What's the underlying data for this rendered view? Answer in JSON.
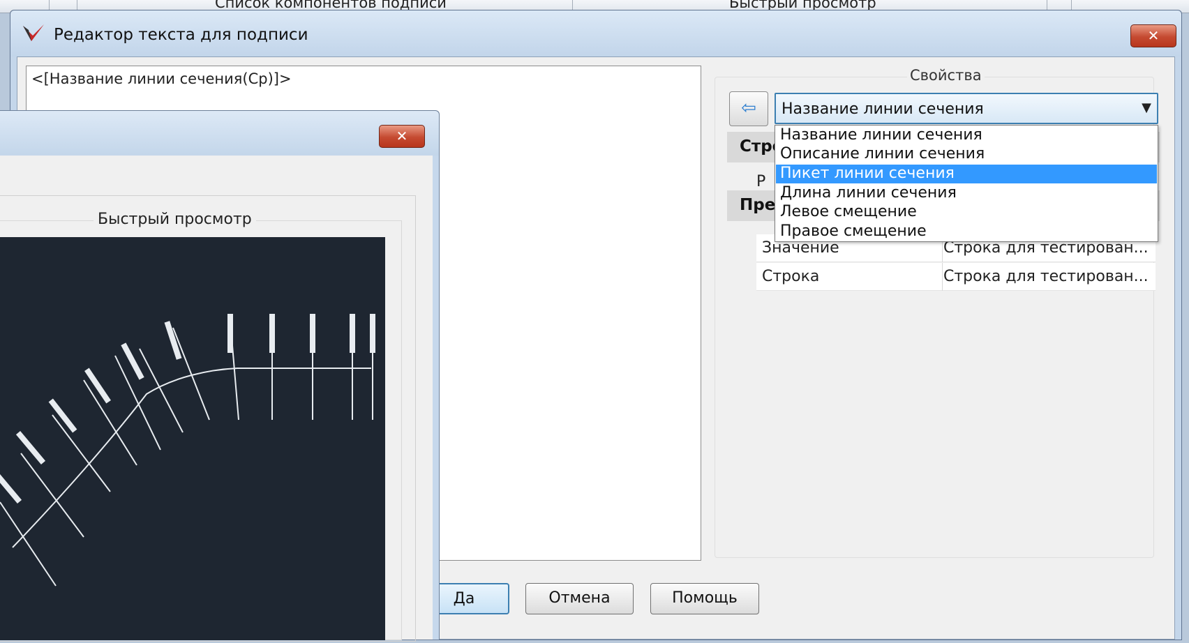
{
  "background_window": {
    "left_text": "Список компонентов подписи",
    "right_text": "Быстрый просмотр"
  },
  "main_dialog": {
    "title": "Редактор текста для подписи",
    "close_label": "✕",
    "editor_text": "<[Название линии сечения(Cp)]>",
    "properties": {
      "group_label": "Свойства",
      "back_label": "⇦",
      "combo_value": "Название линии сечения",
      "combo_arrow": "▼",
      "dropdown_options": [
        "Название линии сечения",
        "Описание линии сечения",
        "Пикет линии сечения",
        "Длина линии сечения",
        "Левое смещение",
        "Правое смещение"
      ],
      "selected_index": 2,
      "section_1": "Стро",
      "section_1_sub": "Р",
      "section_2": "Пре",
      "rows": [
        {
          "key": "Значение",
          "value": "Строка для тестирован..."
        },
        {
          "key": "Строка",
          "value": "Строка для тестирован..."
        }
      ]
    },
    "buttons": {
      "ok": "Да",
      "cancel": "Отмена",
      "help": "Помощь"
    }
  },
  "preview_dialog": {
    "close_label": "✕",
    "group_label": "Быстрый просмотр"
  },
  "colors": {
    "canvas_bg": "#1e2631",
    "selection": "#3399ff",
    "close_red": "#c54a31"
  }
}
